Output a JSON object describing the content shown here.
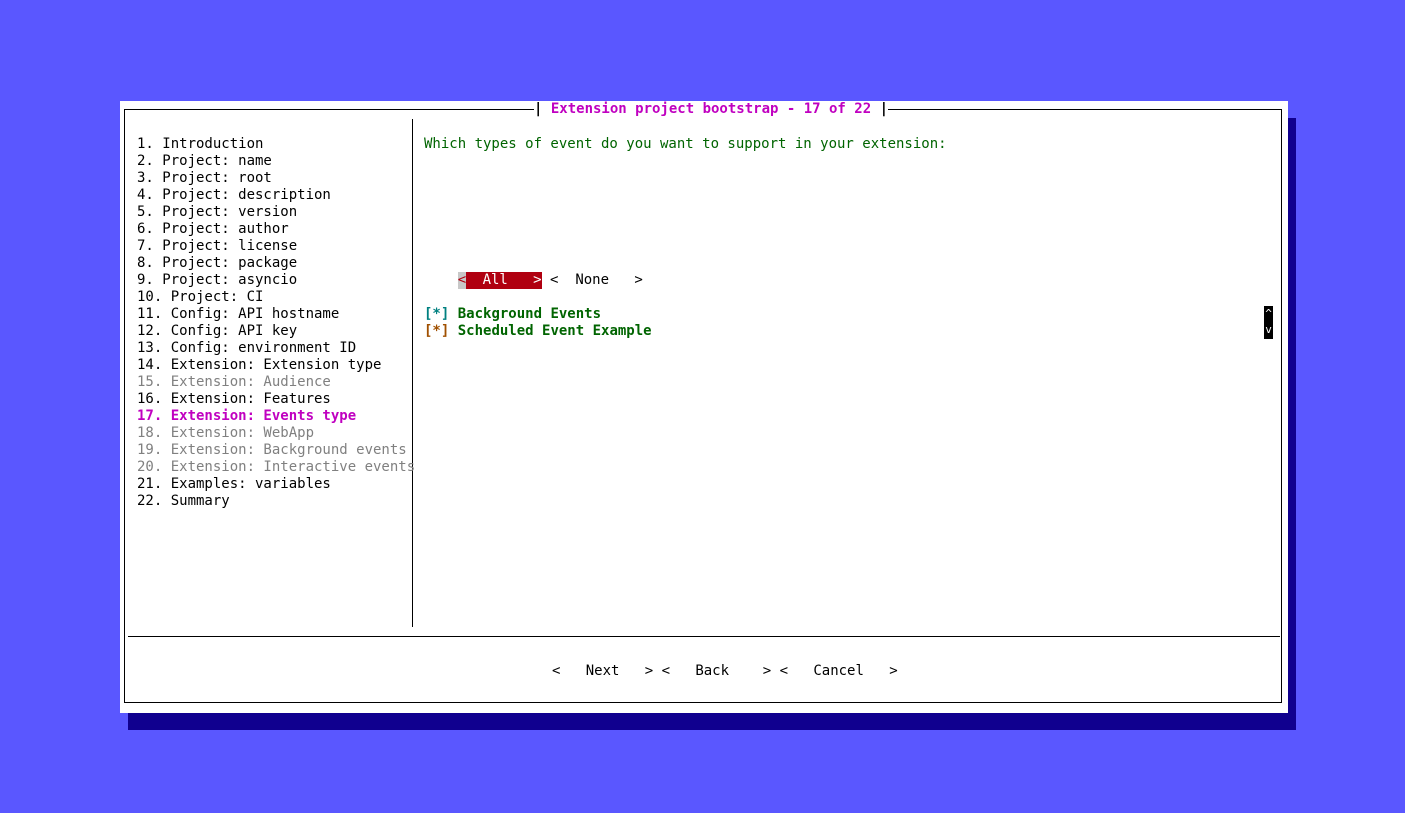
{
  "title": {
    "text": "Extension project bootstrap - 17 of 22"
  },
  "steps": [
    {
      "label": "1. Introduction",
      "state": "done"
    },
    {
      "label": "2. Project: name",
      "state": "done"
    },
    {
      "label": "3. Project: root",
      "state": "done"
    },
    {
      "label": "4. Project: description",
      "state": "done"
    },
    {
      "label": "5. Project: version",
      "state": "done"
    },
    {
      "label": "6. Project: author",
      "state": "done"
    },
    {
      "label": "7. Project: license",
      "state": "done"
    },
    {
      "label": "8. Project: package",
      "state": "done"
    },
    {
      "label": "9. Project: asyncio",
      "state": "done"
    },
    {
      "label": "10. Project: CI",
      "state": "done"
    },
    {
      "label": "11. Config: API hostname",
      "state": "done"
    },
    {
      "label": "12. Config: API key",
      "state": "done"
    },
    {
      "label": "13. Config: environment ID",
      "state": "done"
    },
    {
      "label": "14. Extension: Extension type",
      "state": "done"
    },
    {
      "label": "15. Extension: Audience",
      "state": "pending"
    },
    {
      "label": "16. Extension: Features",
      "state": "done"
    },
    {
      "label": "17. Extension: Events type",
      "state": "current"
    },
    {
      "label": "18. Extension: WebApp",
      "state": "pending"
    },
    {
      "label": "19. Extension: Background events",
      "state": "pending"
    },
    {
      "label": "20. Extension: Interactive events",
      "state": "pending"
    },
    {
      "label": "21. Examples: variables",
      "state": "done"
    },
    {
      "label": "22. Summary",
      "state": "done"
    }
  ],
  "main": {
    "question": "Which types of event do you want to support in your extension:",
    "select_all": "All",
    "select_none": "None",
    "options": [
      {
        "mark": "[*]",
        "label": "Background Events"
      },
      {
        "mark": "[*]",
        "label": "Scheduled Event Example"
      }
    ],
    "scroll_up": "^",
    "scroll_down": "v"
  },
  "footer": {
    "next": "Next",
    "back": "Back",
    "cancel": "Cancel"
  },
  "colors": {
    "background": "#5a57ff",
    "shadow": "#10008f",
    "accent": "#c000c0",
    "button_active": "#b00010",
    "text_green": "#006400"
  }
}
